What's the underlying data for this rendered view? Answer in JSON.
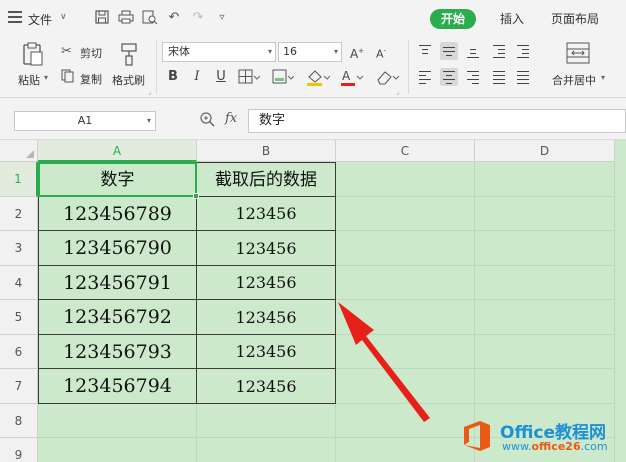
{
  "menubar": {
    "file_label": "文件",
    "tabs": [
      {
        "label": "开始",
        "active": true
      },
      {
        "label": "插入",
        "active": false
      },
      {
        "label": "页面布局",
        "active": false
      }
    ],
    "accent_color": "#2bad4d"
  },
  "ribbon": {
    "paste_label": "粘贴",
    "cut_label": "剪切",
    "copy_label": "复制",
    "format_painter_label": "格式刷",
    "font_name": "宋体",
    "font_size": "16",
    "bold": "B",
    "italic": "I",
    "underline": "U",
    "merge_center_label": "合并居中"
  },
  "formula_bar": {
    "name_box": "A1",
    "fx_label": "fx",
    "content": "数字"
  },
  "grid": {
    "columns": [
      "A",
      "B",
      "C",
      "D"
    ],
    "rows": [
      "1",
      "2",
      "3",
      "4",
      "5",
      "6",
      "7",
      "8",
      "9"
    ],
    "header": {
      "a": "数字",
      "b": "截取后的数据"
    },
    "data": [
      {
        "a": "123456789",
        "b": "123456"
      },
      {
        "a": "123456790",
        "b": "123456"
      },
      {
        "a": "123456791",
        "b": "123456"
      },
      {
        "a": "123456792",
        "b": "123456"
      },
      {
        "a": "123456793",
        "b": "123456"
      },
      {
        "a": "123456794",
        "b": "123456"
      }
    ],
    "active_cell": "A1"
  },
  "watermark": {
    "title": "Office教程网",
    "url_prefix": "www.",
    "url_brand": "office26",
    "url_suffix": ".com"
  }
}
